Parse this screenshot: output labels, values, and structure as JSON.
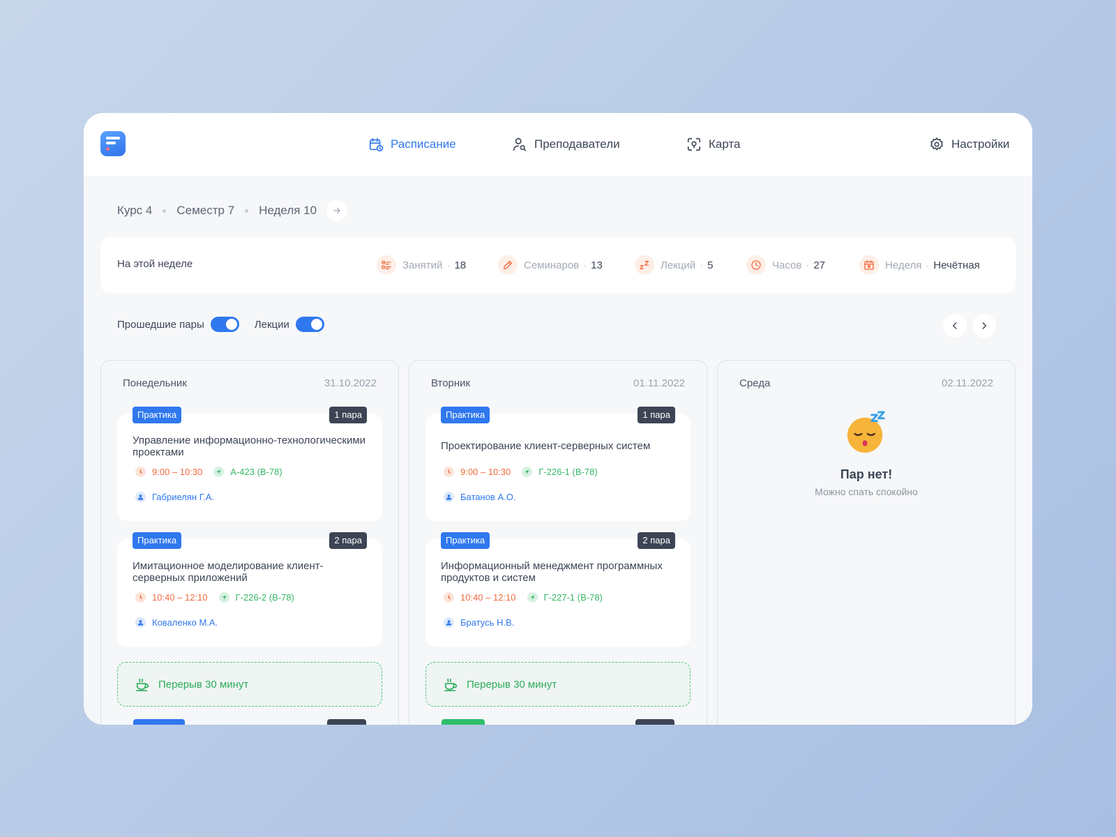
{
  "nav": {
    "schedule": "Расписание",
    "teachers": "Преподаватели",
    "map": "Карта",
    "settings": "Настройки"
  },
  "breadcrumb": {
    "course": "Курс 4",
    "semester": "Семестр 7",
    "week": "Неделя 10"
  },
  "stats": {
    "title": "На этой неделе",
    "items": [
      {
        "label": "Занятий",
        "value": "18",
        "icon": "list-icon"
      },
      {
        "label": "Семинаров",
        "value": "13",
        "icon": "pencil-icon"
      },
      {
        "label": "Лекций",
        "value": "5",
        "icon": "sleep-zz-icon"
      },
      {
        "label": "Часов",
        "value": "27",
        "icon": "clock-icon"
      },
      {
        "label": "Неделя",
        "value": "Нечётная",
        "icon": "calendar-icon"
      }
    ]
  },
  "filters": {
    "past": "Прошедшие пары",
    "lectures": "Лекции"
  },
  "days": [
    {
      "name": "Понедельник",
      "date": "31.10.2022",
      "lessons": [
        {
          "type": "Практика",
          "slot": "1 пара",
          "title": "Управление информационно-технологическими проектами",
          "time": "9:00 – 10:30",
          "room": "А-423 (В-78)",
          "teacher": "Габриелян Г.А."
        },
        {
          "type": "Практика",
          "slot": "2 пара",
          "title": "Имитационное моделирование клиент-серверных приложений",
          "time": "10:40 – 12:10",
          "room": "Г-226-2 (В-78)",
          "teacher": "Коваленко М.А."
        }
      ],
      "break": "Перерыв 30 минут"
    },
    {
      "name": "Вторник",
      "date": "01.11.2022",
      "lessons": [
        {
          "type": "Практика",
          "slot": "1 пара",
          "title": "Проектирование клиент-серверных систем",
          "time": "9:00 – 10:30",
          "room": "Г-226-1 (В-78)",
          "teacher": "Батанов А.О."
        },
        {
          "type": "Практика",
          "slot": "2 пара",
          "title": "Информационный менеджмент программных продуктов и систем",
          "time": "10:40 – 12:10",
          "room": "Г-227-1 (В-78)",
          "teacher": "Братусь Н.В."
        }
      ],
      "break": "Перерыв 30 минут"
    },
    {
      "name": "Среда",
      "date": "02.11.2022",
      "empty_title": "Пар нет!",
      "empty_sub": "Можно спать спокойно"
    }
  ],
  "colors": {
    "accent": "#2f78ee",
    "time": "#f06b3f",
    "room": "#35b765",
    "slot_badge": "#3d4454"
  }
}
